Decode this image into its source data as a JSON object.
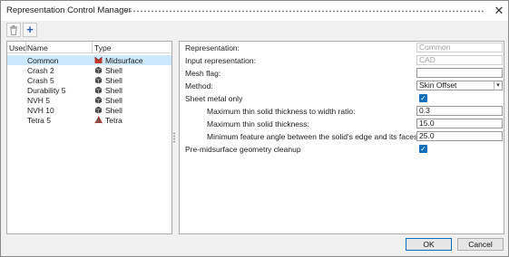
{
  "window": {
    "title": "Representation Control Manager",
    "close_glyph": "✕"
  },
  "toolbar": {
    "delete_icon": "trash-icon",
    "add_icon": "plus-icon",
    "add_glyph": "+",
    "delete_glyph": "🗑"
  },
  "list": {
    "columns": [
      "Used",
      "Name",
      "Type"
    ],
    "rows": [
      {
        "name": "Common",
        "type": "Midsurface",
        "icon": "midsurface-icon",
        "selected": true
      },
      {
        "name": "Crash 2",
        "type": "Shell",
        "icon": "shell-icon",
        "selected": false
      },
      {
        "name": "Crash 5",
        "type": "Shell",
        "icon": "shell-icon",
        "selected": false
      },
      {
        "name": "Durability 5",
        "type": "Shell",
        "icon": "shell-icon",
        "selected": false
      },
      {
        "name": "NVH 5",
        "type": "Shell",
        "icon": "shell-icon",
        "selected": false
      },
      {
        "name": "NVH 10",
        "type": "Shell",
        "icon": "shell-icon",
        "selected": false
      },
      {
        "name": "Tetra 5",
        "type": "Tetra",
        "icon": "tetra-icon",
        "selected": false
      }
    ]
  },
  "properties": {
    "representation": {
      "label": "Representation:",
      "value": "Common"
    },
    "input_representation": {
      "label": "Input representation:",
      "value": "CAD"
    },
    "mesh_flag": {
      "label": "Mesh flag:",
      "value": ""
    },
    "method": {
      "label": "Method:",
      "value": "Skin Offset"
    },
    "sheet_metal_only": {
      "label": "Sheet metal only",
      "checked": true
    },
    "max_thin_ratio": {
      "label": "Maximum thin solid thickness to width ratio:",
      "value": "0.3"
    },
    "max_thin_thickness": {
      "label": "Maximum thin solid thickness:",
      "value": "15.0"
    },
    "min_feature_angle": {
      "label": "Minimum feature angle between the solid's edge and its faces:",
      "value": "25.0"
    },
    "pre_midsurface_cleanup": {
      "label": "Pre-midsurface geometry cleanup",
      "checked": true
    }
  },
  "buttons": {
    "ok": "OK",
    "cancel": "Cancel"
  },
  "colors": {
    "accent": "#0f6cbd",
    "selection": "#cce8ff",
    "midsurface_icon": "#c0392b",
    "shell_icon": "#4a4a4a"
  }
}
